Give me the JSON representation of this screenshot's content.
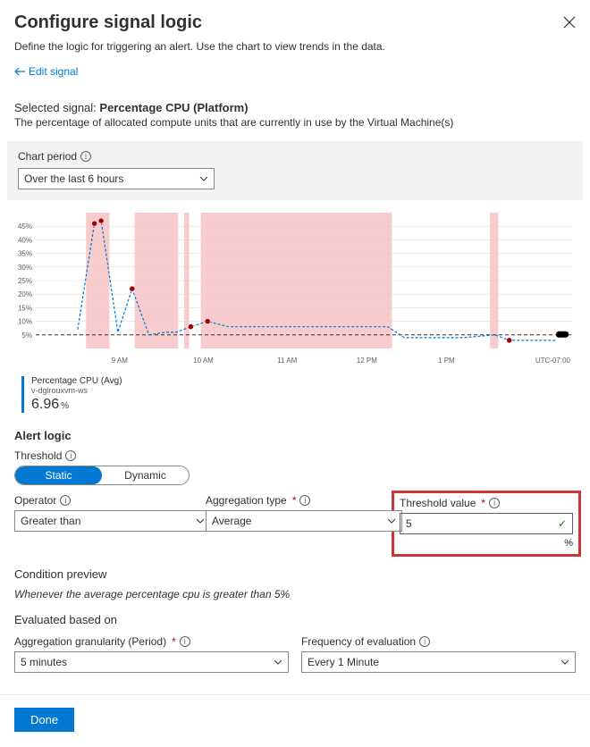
{
  "header": {
    "title": "Configure signal logic",
    "subtitle": "Define the logic for triggering an alert. Use the chart to view trends in the data.",
    "edit_signal": "Edit signal"
  },
  "signal": {
    "label_prefix": "Selected signal: ",
    "name": "Percentage CPU (Platform)",
    "description": "The percentage of allocated compute units that are currently in use by the Virtual Machine(s)"
  },
  "chart_period": {
    "label": "Chart period",
    "value": "Over the last 6 hours"
  },
  "chart_data": {
    "type": "line",
    "title": "",
    "xlabel": "",
    "ylabel": "",
    "ylim": [
      0,
      50
    ],
    "y_ticks": [
      "5%",
      "10%",
      "15%",
      "20%",
      "25%",
      "30%",
      "35%",
      "40%",
      "45%"
    ],
    "x_ticks": [
      "9 AM",
      "10 AM",
      "11 AM",
      "12 PM",
      "1 PM"
    ],
    "timezone": "UTC-07:00",
    "threshold": 5,
    "series": [
      {
        "name": "Percentage CPU (Avg)",
        "source": "v-dgirouxvm-ws",
        "color": "#0078d4",
        "points": [
          {
            "x": 50,
            "y": 7
          },
          {
            "x": 70,
            "y": 46
          },
          {
            "x": 78,
            "y": 47
          },
          {
            "x": 98,
            "y": 6
          },
          {
            "x": 115,
            "y": 22
          },
          {
            "x": 135,
            "y": 5
          },
          {
            "x": 155,
            "y": 6
          },
          {
            "x": 168,
            "y": 6
          },
          {
            "x": 185,
            "y": 8
          },
          {
            "x": 205,
            "y": 10
          },
          {
            "x": 230,
            "y": 8
          },
          {
            "x": 280,
            "y": 8
          },
          {
            "x": 330,
            "y": 8
          },
          {
            "x": 380,
            "y": 8
          },
          {
            "x": 420,
            "y": 8
          },
          {
            "x": 440,
            "y": 4
          },
          {
            "x": 470,
            "y": 4
          },
          {
            "x": 510,
            "y": 4
          },
          {
            "x": 548,
            "y": 5
          },
          {
            "x": 565,
            "y": 3
          },
          {
            "x": 600,
            "y": 3
          },
          {
            "x": 620,
            "y": 3
          }
        ]
      }
    ],
    "highlight_bands_x": [
      [
        60,
        88
      ],
      [
        118,
        170
      ],
      [
        177,
        183
      ],
      [
        197,
        425
      ],
      [
        542,
        552
      ]
    ],
    "legend_value": "6.96",
    "legend_unit": "%"
  },
  "alert_logic": {
    "heading": "Alert logic",
    "threshold_label": "Threshold",
    "threshold_options": {
      "static": "Static",
      "dynamic": "Dynamic"
    },
    "operator_label": "Operator",
    "operator_value": "Greater than",
    "agg_type_label": "Aggregation type",
    "agg_type_value": "Average",
    "threshold_value_label": "Threshold value",
    "threshold_value": "5",
    "threshold_unit": "%"
  },
  "condition_preview": {
    "heading": "Condition preview",
    "text": "Whenever the average percentage cpu is greater than 5%"
  },
  "evaluated": {
    "heading": "Evaluated based on",
    "granularity_label": "Aggregation granularity (Period)",
    "granularity_value": "5 minutes",
    "frequency_label": "Frequency of evaluation",
    "frequency_value": "Every 1 Minute"
  },
  "footer": {
    "done": "Done"
  }
}
